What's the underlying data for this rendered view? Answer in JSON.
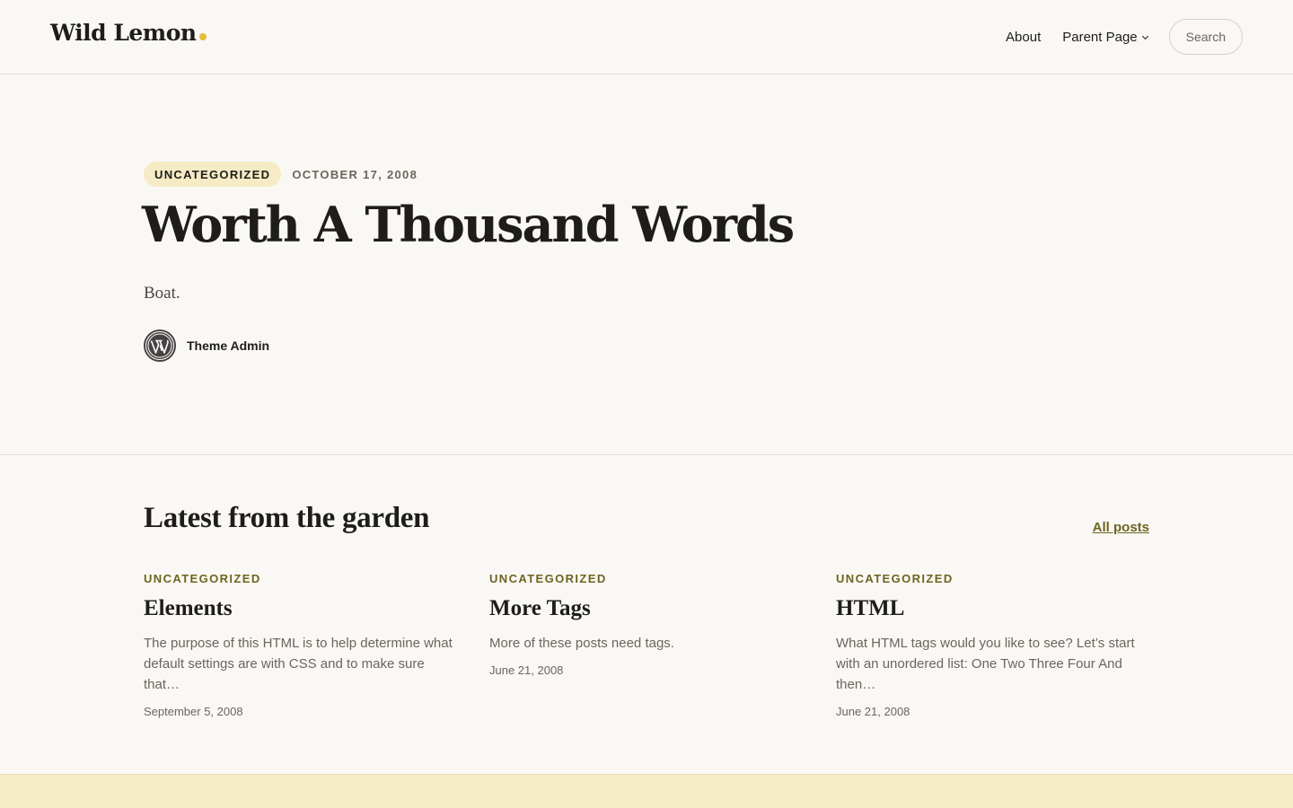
{
  "header": {
    "brand": "Wild Lemon",
    "nav": {
      "about": "About",
      "parent_page": "Parent Page"
    },
    "search_label": "Search"
  },
  "hero": {
    "category": "UNCATEGORIZED",
    "date": "OCTOBER 17, 2008",
    "title": "Worth A Thousand Words",
    "excerpt": "Boat.",
    "author": "Theme Admin",
    "avatar_icon": "wordpress-logo-icon"
  },
  "latest": {
    "title": "Latest from the garden",
    "all_posts": "All posts",
    "posts": [
      {
        "category": "UNCATEGORIZED",
        "title": "Elements",
        "excerpt": "The purpose of this HTML is to help determine what default settings are with CSS and to make sure that…",
        "date": "September 5, 2008"
      },
      {
        "category": "UNCATEGORIZED",
        "title": "More Tags",
        "excerpt": "More of these posts need tags.",
        "date": "June 21, 2008"
      },
      {
        "category": "UNCATEGORIZED",
        "title": "HTML",
        "excerpt": "What HTML tags would you like to see? Let’s start with an unordered list: One Two Three Four And then…",
        "date": "June 21, 2008"
      }
    ]
  },
  "colors": {
    "background": "#f9f8f4",
    "accent": "#e9bd3a",
    "pill": "#f5ebc4",
    "link": "#6e6420",
    "text": "#1f1d1a"
  }
}
